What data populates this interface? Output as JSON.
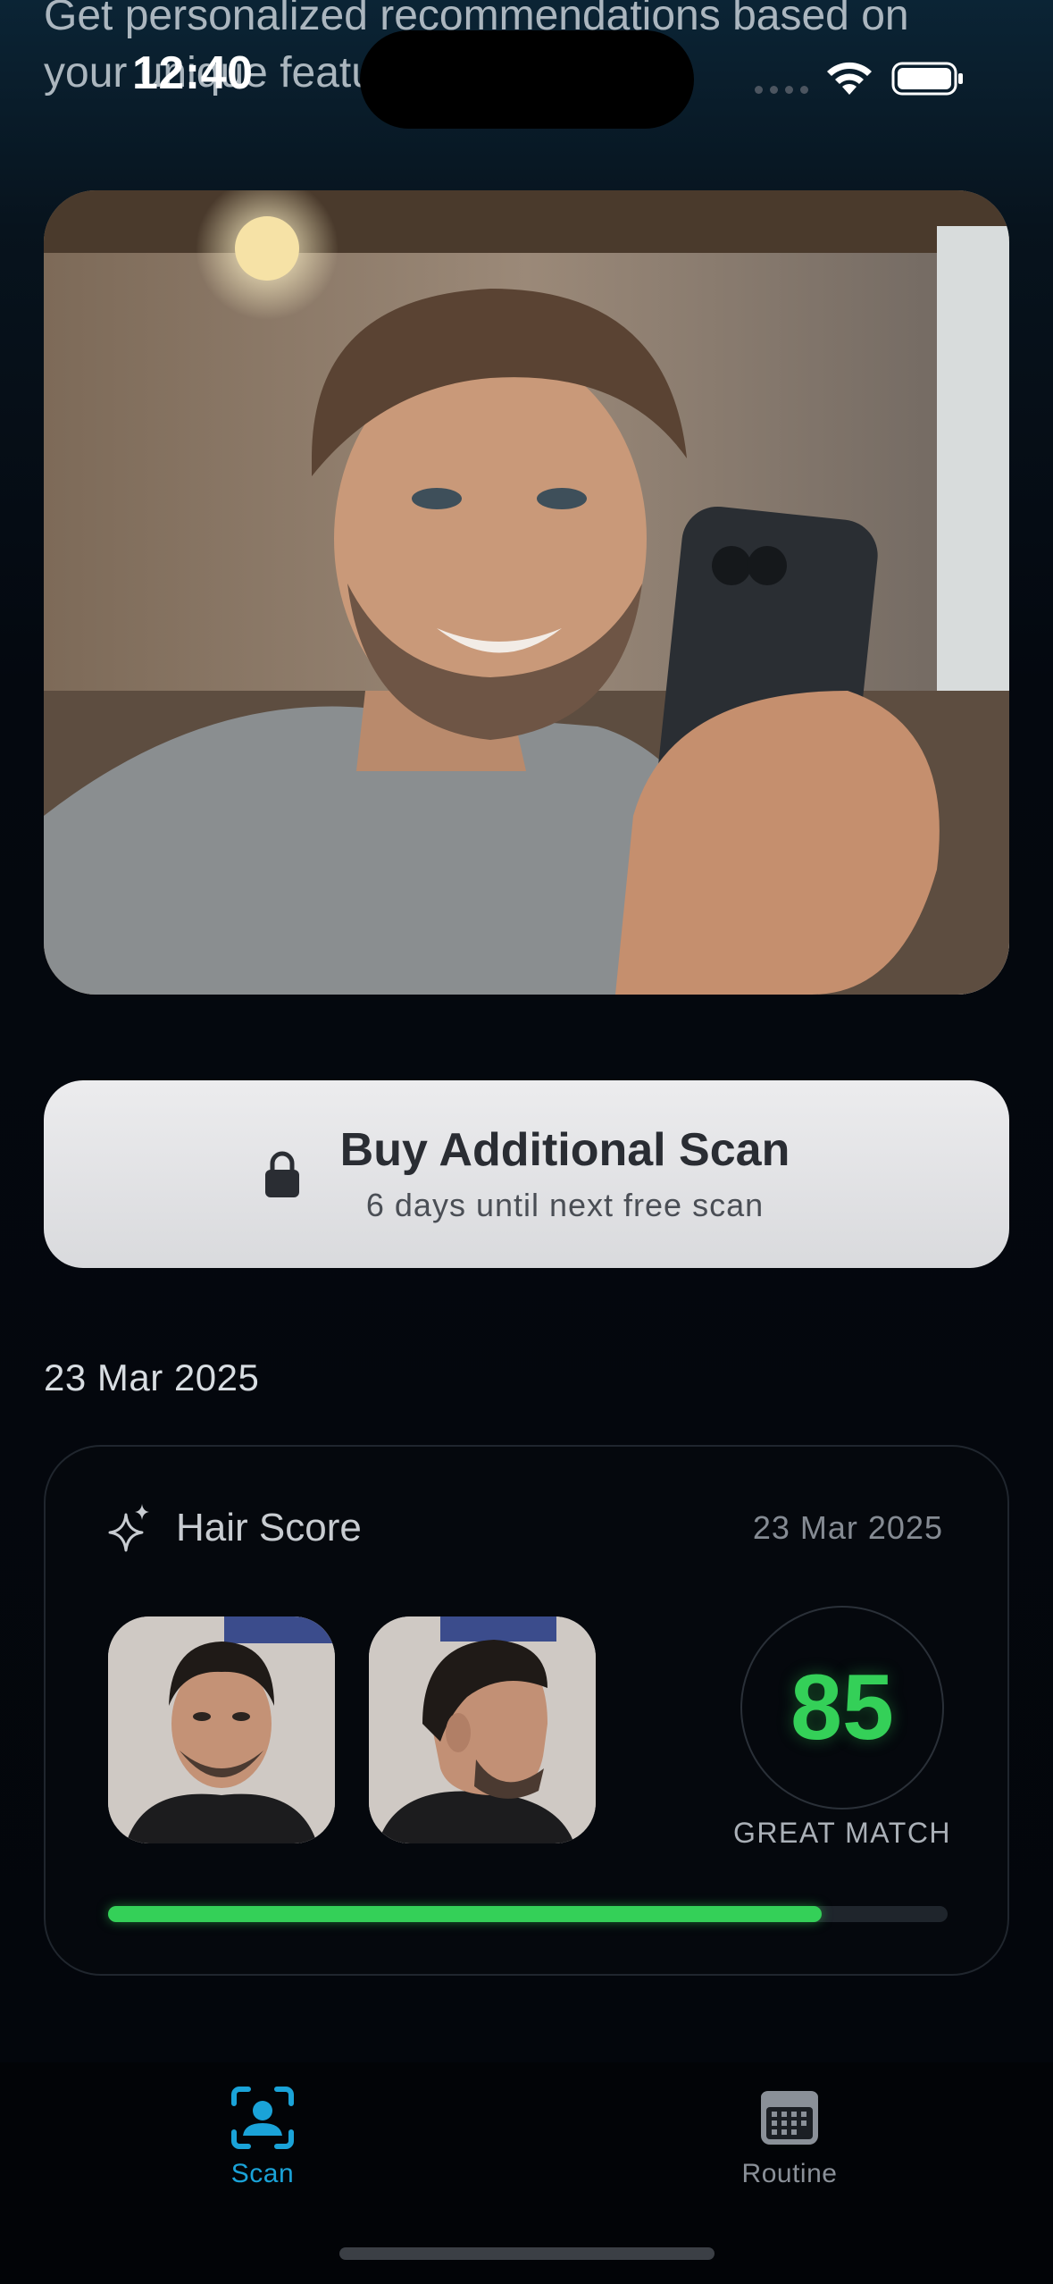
{
  "intro": {
    "line1": "Get personalized recommendations based on",
    "line2": "your unique features"
  },
  "status_bar": {
    "time": "12:40"
  },
  "hero": {
    "icon": "smiling-man-holding-phone-photo"
  },
  "buy_scan": {
    "title": "Buy Additional Scan",
    "subtitle": "6 days until next free scan",
    "icon": "lock-icon"
  },
  "history": {
    "date_header": "23 Mar 2025"
  },
  "score_card": {
    "title": "Hair Score",
    "date": "23 Mar 2025",
    "score": "85",
    "label": "GREAT MATCH",
    "progress": 0.85,
    "accent": "#34d058",
    "photos": [
      "front-face-photo",
      "side-profile-photo"
    ]
  },
  "tabbar": {
    "tabs": [
      {
        "label": "Scan",
        "icon": "face-scan-icon",
        "active": true,
        "color": "#1aa3d8"
      },
      {
        "label": "Routine",
        "icon": "calendar-icon",
        "active": false,
        "color": "#8a9098"
      }
    ]
  }
}
